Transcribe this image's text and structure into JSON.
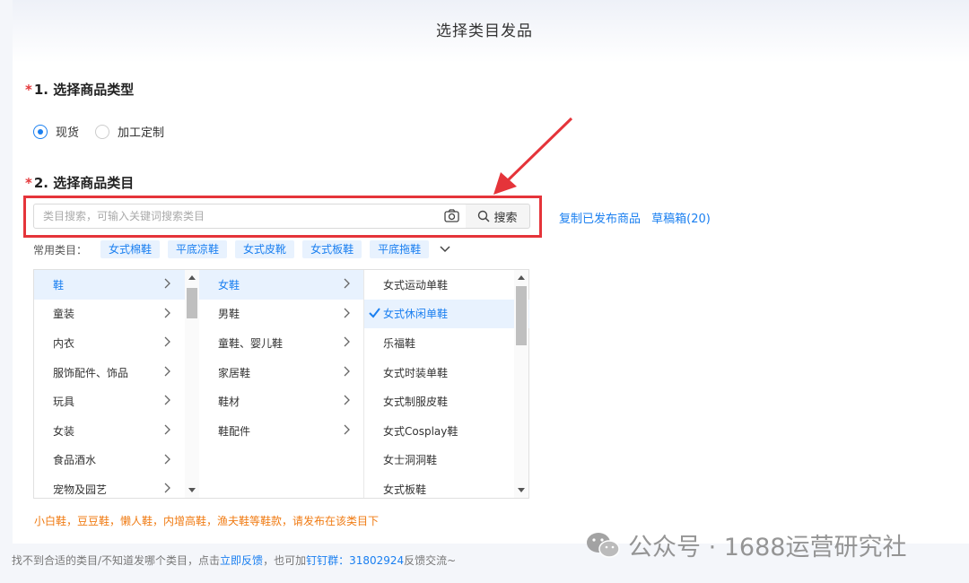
{
  "page": {
    "title": "选择类目发品"
  },
  "section1": {
    "required_mark": "*",
    "title": "1. 选择商品类型",
    "options": [
      {
        "label": "现货",
        "checked": true
      },
      {
        "label": "加工定制",
        "checked": false
      }
    ]
  },
  "section2": {
    "required_mark": "*",
    "title": "2. 选择商品类目"
  },
  "search": {
    "placeholder": "类目搜索，可输入关键词搜索类目",
    "button_label": "搜索",
    "camera_icon": "camera-icon",
    "search_icon": "search-icon"
  },
  "links": {
    "copy_published": "复制已发布商品",
    "drafts": "草稿箱(20)"
  },
  "common_categories": {
    "label": "常用类目：",
    "tags": [
      "女式棉鞋",
      "平底凉鞋",
      "女式皮靴",
      "女式板鞋",
      "平底拖鞋"
    ]
  },
  "cascader": {
    "level1": [
      {
        "label": "鞋",
        "active": true
      },
      {
        "label": "童装",
        "active": false
      },
      {
        "label": "内衣",
        "active": false
      },
      {
        "label": "服饰配件、饰品",
        "active": false
      },
      {
        "label": "玩具",
        "active": false
      },
      {
        "label": "女装",
        "active": false
      },
      {
        "label": "食品酒水",
        "active": false
      },
      {
        "label": "宠物及园艺",
        "active": false
      }
    ],
    "level2": [
      {
        "label": "女鞋",
        "active": true
      },
      {
        "label": "男鞋",
        "active": false
      },
      {
        "label": "童鞋、婴儿鞋",
        "active": false
      },
      {
        "label": "家居鞋",
        "active": false
      },
      {
        "label": "鞋材",
        "active": false
      },
      {
        "label": "鞋配件",
        "active": false
      }
    ],
    "level3": [
      {
        "label": "女式运动单鞋",
        "active": false
      },
      {
        "label": "女式休闲单鞋",
        "active": true
      },
      {
        "label": "乐福鞋",
        "active": false
      },
      {
        "label": "女式时装单鞋",
        "active": false
      },
      {
        "label": "女式制服皮鞋",
        "active": false
      },
      {
        "label": "女式Cosplay鞋",
        "active": false
      },
      {
        "label": "女士洞洞鞋",
        "active": false
      },
      {
        "label": "女式板鞋",
        "active": false
      }
    ]
  },
  "hint": "小白鞋，豆豆鞋，懒人鞋，内增高鞋，渔夫鞋等鞋款，请发布在该类目下",
  "footer": {
    "text_before": "找不到合适的类目/不知道发哪个类目，点击",
    "feedback_link": "立即反馈",
    "text_middle": "，也可加",
    "dingtalk_label": "钉钉群：",
    "group_number": "31802924",
    "text_after": "反馈交流~"
  },
  "watermark": {
    "text": "公众号 · 1688运营研究社"
  },
  "colors": {
    "accent": "#1a7ff0",
    "highlight_box": "#e5343a",
    "hint": "#f07b13"
  }
}
